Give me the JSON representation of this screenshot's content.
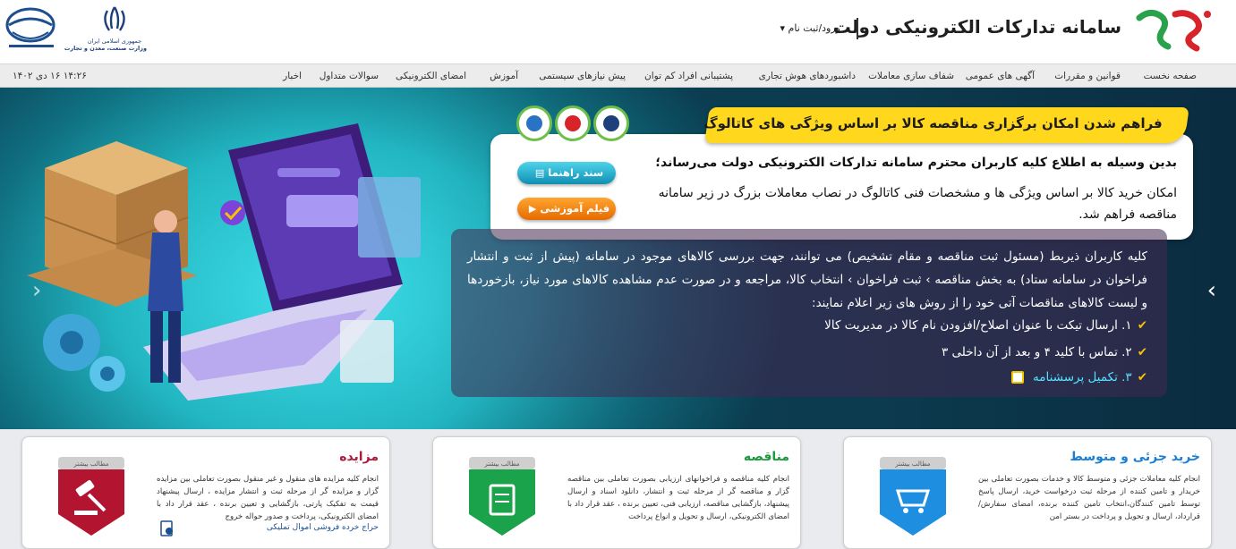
{
  "header": {
    "site_title": "سامانه تدارکات الکترونیکی دولت",
    "login_label": "ورود/ثبت نام ▾",
    "emblem_caption_line1": "جمهوری اسلامی ایران",
    "emblem_caption_line2": "وزارت صنعت، معدن و تجارت"
  },
  "nav": {
    "items": [
      "صفحه نخست",
      "قوانین و مقررات",
      "آگهی های عمومی",
      "شفاف سازی معاملات",
      "داشبوردهای هوش تجاری",
      "پشتیبانی افراد کم توان",
      "پیش نیازهای سیستمی",
      "آموزش",
      "امضای الکترونیکی",
      "سوالات متداول",
      "اخبار"
    ],
    "datetime": "۱۴:۲۶ ۱۶ دی ۱۴۰۲"
  },
  "banner": {
    "headline": "فراهم شدن امکان برگزاری مناقصه کالا بر اساس ویژگی های کاتالوگ",
    "notice_line1": "بدین وسیله به اطلاع کلیه کاربران محترم سامانه تدارکات الکترونیکی دولت می‌رساند؛",
    "notice_line2": "امکان خرید کالا بر اساس ویژگی ها و مشخصات فنی کاتالوگ در نصاب معاملات بزرگ در زیر سامانه مناقصه فراهم شد.",
    "guide_button": "سند راهنما",
    "video_button": "فیلم آموزشی",
    "info_paragraph": "کلیه کاربران ذیربط (مسئول ثبت مناقصه و مقام تشخیص) می توانند، جهت بررسی کالاهای موجود در سامانه (پیش از ثبت و انتشار فراخوان در سامانه ستاد) به بخش مناقصه › ثبت فراخوان › انتخاب کالا، مراجعه و در صورت عدم مشاهده کالاهای مورد نیاز، بازخوردها و لیست کالاهای مناقصات آتی خود را از روش های زیر اعلام نمایند:",
    "items": [
      "۱. ارسال تیکت با عنوان اصلاح/افزودن نام کالا در مدیریت کالا",
      "۲. تماس با کلید ۴ و بعد از آن داخلی ۳",
      "۳. تکمیل پرسشنامه"
    ]
  },
  "cards": [
    {
      "title": "خرید جزئی و متوسط",
      "title_color": "#1a7fd4",
      "badge_label": "مطالب بیشتر",
      "badge_color": "#1e8fe0",
      "description": "انجام کلیه معاملات جزئی و متوسط کالا و خدمات بصورت تعاملی بین خریدار و تامین کننده از مرحله ثبت درخواست خرید، ارسال پاسخ توسط تامین کنندگان،انتخاب تامین کننده برنده، امضای سفارش/ قرارداد، ارسال و تحویل و پرداخت در بستر امن"
    },
    {
      "title": "مناقصه",
      "title_color": "#1a9a3c",
      "badge_label": "مطالب بیشتر",
      "badge_color": "#1aa34a",
      "description": "انجام کلیه مناقصه و فراخوانهای ارزیابی بصورت تعاملی بین مناقصه گزار و مناقصه گر از مرحله ثبت و انتشار، دانلود اسناد و ارسال پیشنهاد، بازگشایی مناقصه، ارزیابی فنی، تعیین برنده ، عقد قرار داد با امضای الکترونیکی، ارسال و تحویل و انواع پرداخت"
    },
    {
      "title": "مزایده",
      "title_color": "#b01a3a",
      "badge_label": "مطالب بیشتر",
      "badge_color": "#b3142f",
      "description": "انجام کلیه مزایده های منقول و غیر منقول بصورت تعاملی بین مزایده گزار و مزایده گر از مرحله ثبت و انتشار مزایده ، ارسال پیشنهاد قیمت به تفکیک پارتی، بازگشایی و تعیین برنده ، عقد قرار داد با امضای الکترونیکی، پرداخت و صدور حواله خروج",
      "link": "حراج خرده فروشی اموال تملیکی"
    }
  ],
  "colors": {
    "banner_teal": "#22b6c2",
    "headline_yellow": "#ffd71c",
    "check_yellow": "#f5c400"
  }
}
